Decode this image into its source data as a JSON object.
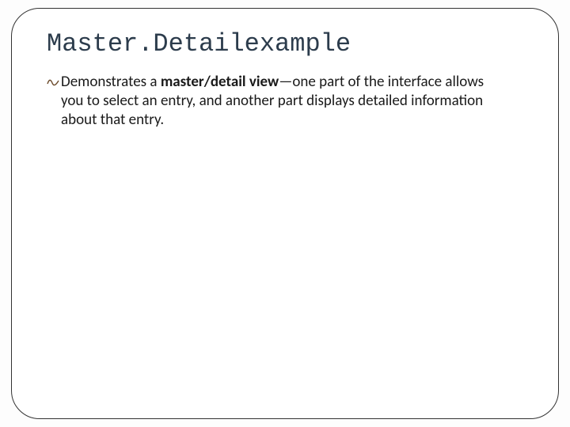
{
  "slide": {
    "title": "Master.Detailexample",
    "bullet": {
      "lead": "Demonstrates a ",
      "bold": "master/detail view",
      "tail": "—one part of the interface allows you to select an entry, and another part displays detailed information about that entry."
    }
  }
}
